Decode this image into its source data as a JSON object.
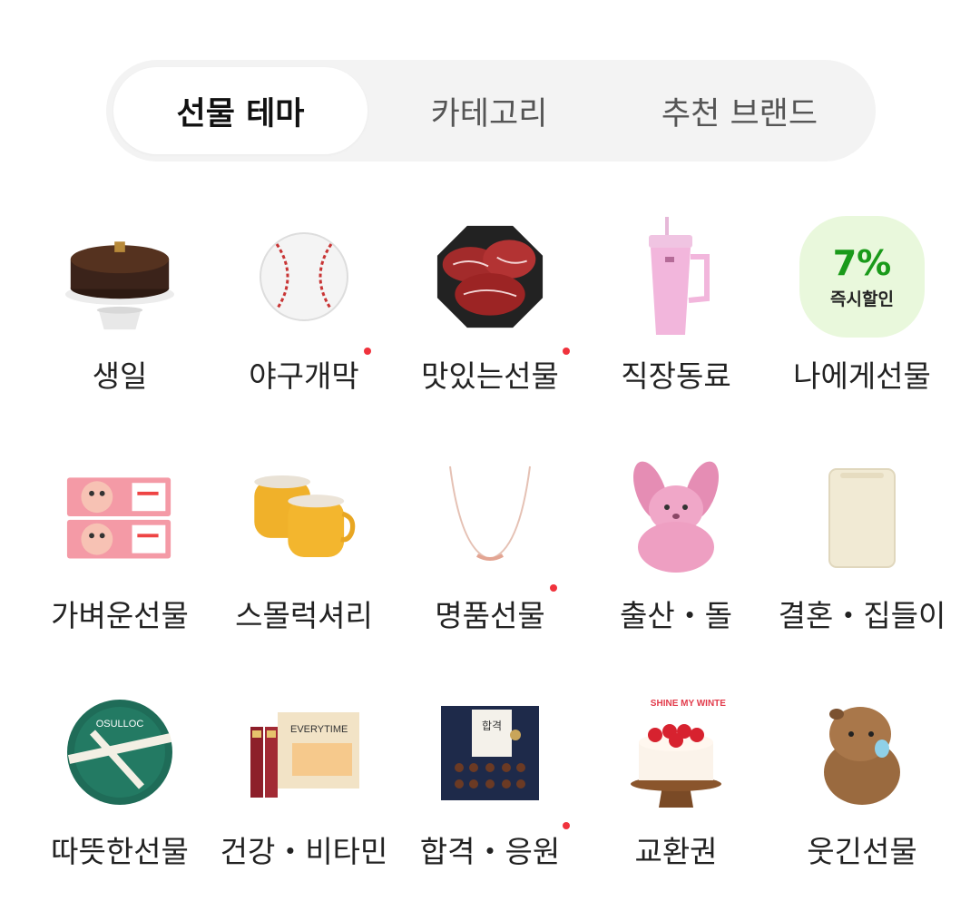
{
  "tabs": [
    {
      "label": "선물 테마",
      "active": true
    },
    {
      "label": "카테고리",
      "active": false
    },
    {
      "label": "추천 브랜드",
      "active": false
    }
  ],
  "categories": [
    {
      "label": "생일",
      "icon": "cake-icon",
      "new": false
    },
    {
      "label": "야구개막",
      "icon": "baseball-icon",
      "new": true
    },
    {
      "label": "맛있는선물",
      "icon": "beef-icon",
      "new": true
    },
    {
      "label": "직장동료",
      "icon": "tumbler-icon",
      "new": false
    },
    {
      "label": "나에게선물",
      "icon": "discount-badge-icon",
      "new": false
    },
    {
      "label": "가벼운선물",
      "icon": "cookie-box-icon",
      "new": false
    },
    {
      "label": "스몰럭셔리",
      "icon": "mug-icon",
      "new": false
    },
    {
      "label": "명품선물",
      "icon": "necklace-icon",
      "new": true
    },
    {
      "label": "출산・돌",
      "icon": "bunny-plush-icon",
      "new": false
    },
    {
      "label": "결혼・집들이",
      "icon": "humidifier-icon",
      "new": false
    },
    {
      "label": "따뜻한선물",
      "icon": "tea-gift-box-icon",
      "new": false
    },
    {
      "label": "건강・비타민",
      "icon": "red-ginseng-box-icon",
      "new": false
    },
    {
      "label": "합격・응원",
      "icon": "chocolate-box-icon",
      "new": true
    },
    {
      "label": "교환권",
      "icon": "strawberry-cake-icon",
      "new": false
    },
    {
      "label": "웃긴선물",
      "icon": "capybara-plush-icon",
      "new": false
    }
  ],
  "badge": {
    "percent": "7%",
    "text": "즉시할인"
  },
  "product_text": {
    "tea_brand": "OSULLOC",
    "vitamin_brand": "EVERYTIME",
    "choco_label": "합격",
    "cake_topper": "SHINE MY WINTER"
  },
  "colors": {
    "accent_dot": "#f0323c",
    "badge_green": "#1a9a1a",
    "badge_bg": "#e9f8dc"
  }
}
